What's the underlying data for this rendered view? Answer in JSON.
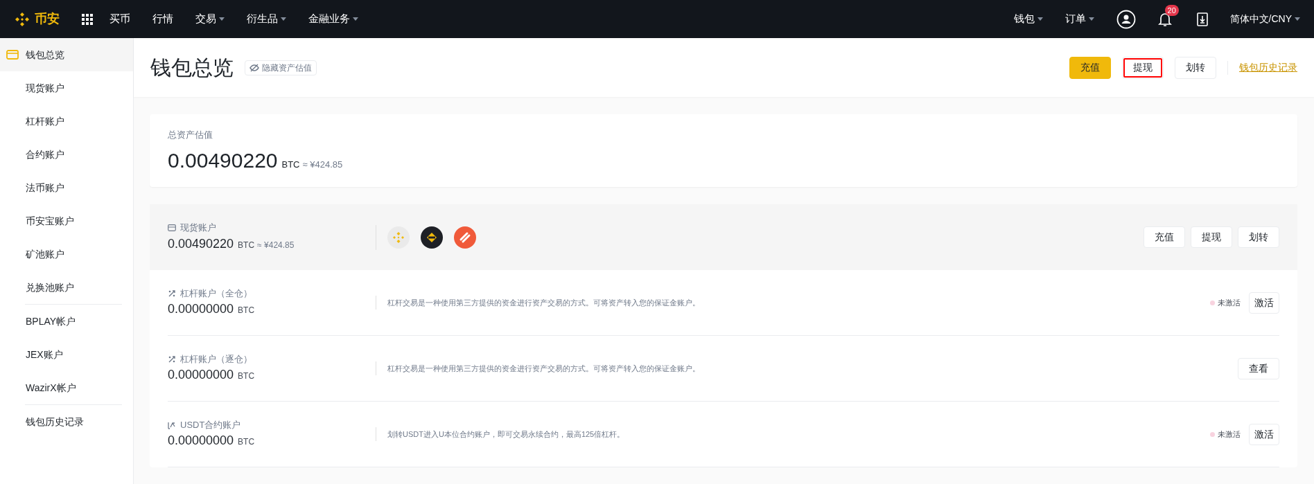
{
  "topbar": {
    "logo": "币安",
    "nav": [
      {
        "label": "买币",
        "dropdown": false
      },
      {
        "label": "行情",
        "dropdown": false
      },
      {
        "label": "交易",
        "dropdown": true
      },
      {
        "label": "衍生品",
        "dropdown": true
      },
      {
        "label": "金融业务",
        "dropdown": true
      }
    ],
    "right_menus": [
      {
        "label": "钱包"
      },
      {
        "label": "订单"
      }
    ],
    "notification_count": "20",
    "language": "简体中文/CNY"
  },
  "sidebar": {
    "groups": [
      [
        {
          "label": "钱包总览",
          "selected": true
        },
        {
          "label": "现货账户",
          "selected": false
        },
        {
          "label": "杠杆账户",
          "selected": false
        },
        {
          "label": "合约账户",
          "selected": false
        },
        {
          "label": "法币账户",
          "selected": false
        },
        {
          "label": "币安宝账户",
          "selected": false
        },
        {
          "label": "矿池账户",
          "selected": false
        },
        {
          "label": "兑换池账户",
          "selected": false
        }
      ],
      [
        {
          "label": "BPLAY帐户",
          "selected": false
        },
        {
          "label": "JEX账户",
          "selected": false
        },
        {
          "label": "WazirX帐户",
          "selected": false
        }
      ],
      [
        {
          "label": "钱包历史记录",
          "selected": false
        }
      ]
    ]
  },
  "header": {
    "title": "钱包总览",
    "hide_toggle": "隐藏资产估值",
    "buttons": [
      {
        "label": "充值",
        "kind": "primary",
        "highlighted": false
      },
      {
        "label": "提现",
        "kind": "default",
        "highlighted": true
      },
      {
        "label": "划转",
        "kind": "default",
        "highlighted": false
      }
    ],
    "history_link": "钱包历史记录"
  },
  "total": {
    "label": "总资产估值",
    "amount": "0.00490220",
    "unit": "BTC",
    "approx": "≈ ¥424.85"
  },
  "spot": {
    "label": "现货账户",
    "amount": "0.00490220",
    "unit": "BTC",
    "approx": "≈ ¥424.85",
    "buttons": [
      "充值",
      "提现",
      "划转"
    ]
  },
  "accounts": [
    {
      "kind": "margin",
      "label": "杠杆账户（全仓）",
      "amount": "0.00000000",
      "unit": "BTC",
      "description": "杠杆交易是一种使用第三方提供的资金进行资产交易的方式。可将资产转入您的保证金账户。",
      "status": {
        "text": "未激活",
        "color": "#f8d3df"
      },
      "action": "激活"
    },
    {
      "kind": "margin",
      "label": "杠杆账户（逐仓）",
      "amount": "0.00000000",
      "unit": "BTC",
      "description": "杠杆交易是一种使用第三方提供的资金进行资产交易的方式。可将资产转入您的保证金账户。",
      "action": "查看"
    },
    {
      "kind": "futures",
      "label": "USDT合约账户",
      "amount": "0.00000000",
      "unit": "BTC",
      "description": "划转USDT进入U本位合约账户，即可交易永续合约，最高125倍杠杆。",
      "status": {
        "text": "未激活",
        "color": "#f8d3df"
      },
      "action": "激活"
    }
  ]
}
